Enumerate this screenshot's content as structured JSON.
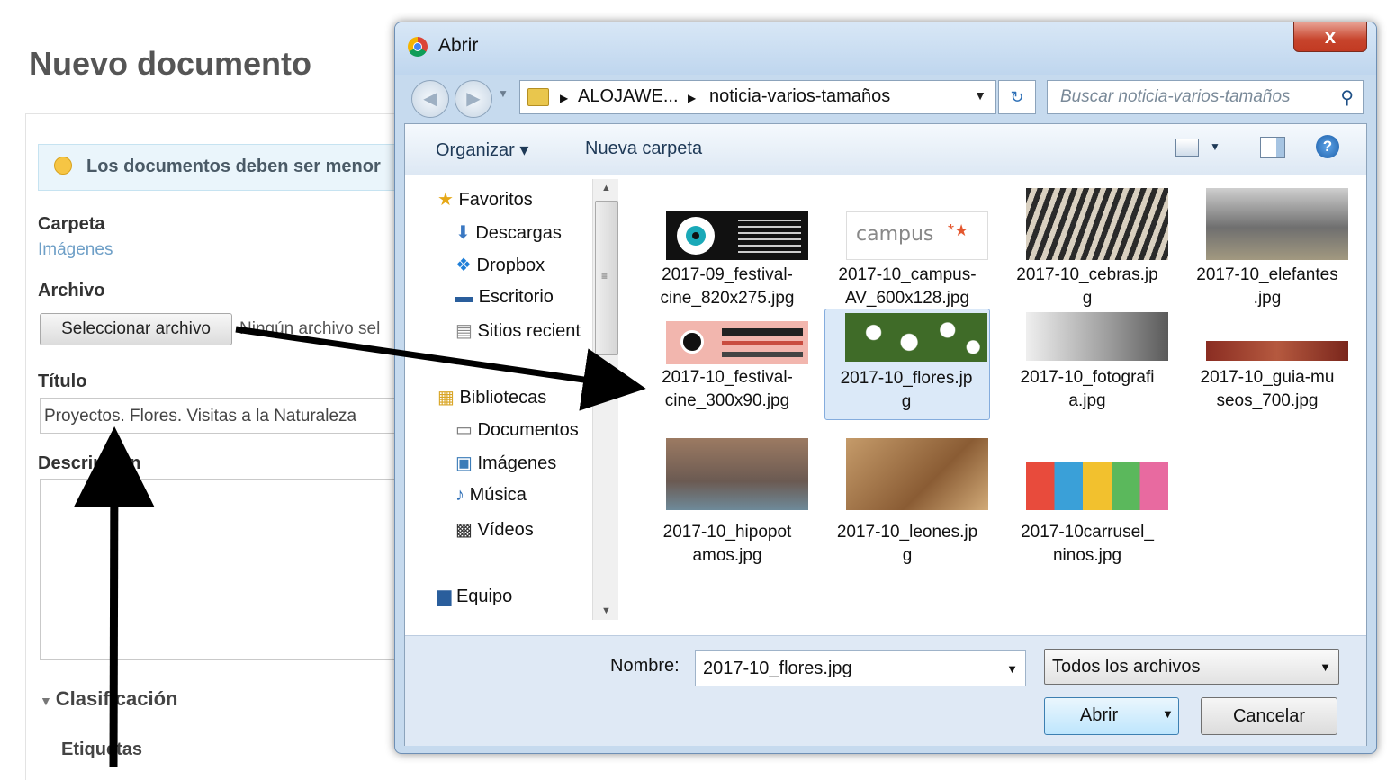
{
  "background_page": {
    "title": "Nuevo documento",
    "info_text": "Los documentos deben ser menor",
    "carpeta_label": "Carpeta",
    "carpeta_link": "Imágenes",
    "archivo_label": "Archivo",
    "select_file_button": "Seleccionar archivo",
    "no_file_text": "Ningún archivo sel",
    "titulo_label": "Título",
    "titulo_value": "Proyectos. Flores. Visitas a la Naturaleza",
    "descripcion_label": "Descripción",
    "clasificacion_label": "Clasificación",
    "etiquetas_label": "Etiquetas"
  },
  "dialog": {
    "title": "Abrir",
    "close_label": "x",
    "address": {
      "crumbs": [
        "ALOJAWE...",
        "noticia-varios-tamaños"
      ]
    },
    "search_placeholder": "Buscar noticia-varios-tamaños",
    "toolbar": {
      "organize": "Organizar ▾",
      "new_folder": "Nueva carpeta"
    },
    "sidebar": {
      "favorites_header": "Favoritos",
      "favorites": [
        "Descargas",
        "Dropbox",
        "Escritorio",
        "Sitios recient"
      ],
      "libraries_header": "Bibliotecas",
      "libraries": [
        "Documentos",
        "Imágenes",
        "Música",
        "Vídeos"
      ],
      "computer": "Equipo"
    },
    "files": [
      {
        "name": "2017-09_festival-cine_820x275.jpg",
        "line1": "2017-09_festival-",
        "line2": "cine_820x275.jpg"
      },
      {
        "name": "2017-10_campus-AV_600x128.jpg",
        "line1": "2017-10_campus-",
        "line2": "AV_600x128.jpg",
        "thumb_text": "campus"
      },
      {
        "name": "2017-10_cebras.jpg",
        "line1": "2017-10_cebras.jp",
        "line2": "g"
      },
      {
        "name": "2017-10_elefantes.jpg",
        "line1": "2017-10_elefantes",
        "line2": ".jpg"
      },
      {
        "name": "2017-10_festival-cine_300x90.jpg",
        "line1": "2017-10_festival-",
        "line2": "cine_300x90.jpg"
      },
      {
        "name": "2017-10_flores.jpg",
        "line1": "2017-10_flores.jp",
        "line2": "g",
        "selected": true
      },
      {
        "name": "2017-10_fotografia.jpg",
        "line1": "2017-10_fotografi",
        "line2": "a.jpg"
      },
      {
        "name": "2017-10_guia-museos_700.jpg",
        "line1": "2017-10_guia-mu",
        "line2": "seos_700.jpg"
      },
      {
        "name": "2017-10_hipopotamos.jpg",
        "line1": "2017-10_hipopot",
        "line2": "amos.jpg"
      },
      {
        "name": "2017-10_leones.jpg",
        "line1": "2017-10_leones.jp",
        "line2": "g"
      },
      {
        "name": "2017-10carrusel_ninos.jpg",
        "line1": "2017-10carrusel_",
        "line2": "ninos.jpg"
      }
    ],
    "filename_label": "Nombre:",
    "filename_value": "2017-10_flores.jpg",
    "filetype_value": "Todos los archivos",
    "open_button": "Abrir",
    "cancel_button": "Cancelar"
  },
  "colors": {
    "dialog_frame": "#c6daee",
    "selection": "#dbe9f8",
    "close_button": "#c7442c",
    "link": "#6e9fc7"
  }
}
